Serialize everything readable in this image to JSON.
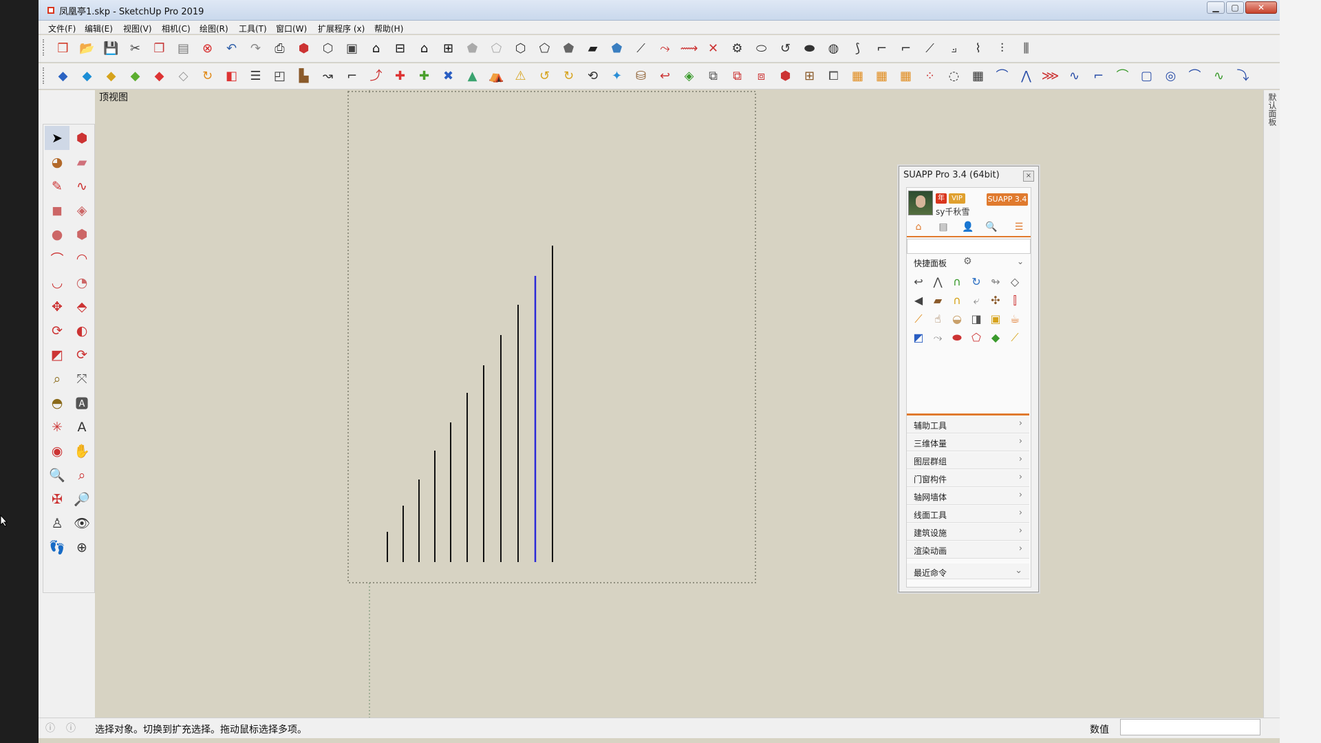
{
  "window": {
    "title": "凤凰亭1.skp - SketchUp Pro 2019",
    "buttons": {
      "minimize": "▁",
      "maximize": "▢",
      "close": "✕"
    }
  },
  "menubar": {
    "items": [
      "文件(F)",
      "编辑(E)",
      "视图(V)",
      "相机(C)",
      "绘图(R)",
      "工具(T)",
      "窗口(W)",
      "扩展程序 (x)",
      "帮助(H)"
    ]
  },
  "viewport": {
    "scene_label": "顶视图"
  },
  "status": {
    "text": "选择对象。切换到扩充选择。拖动鼠标选择多项。",
    "value_label": "数值",
    "value": ""
  },
  "right_strip": {
    "tab_label": "默认面板"
  },
  "suapp": {
    "title": "SUAPP Pro 3.4 (64bit)",
    "close": "×",
    "user_name": "sy千秋雪",
    "badges": [
      "年",
      "VIP",
      "SUAPP 3.4"
    ],
    "quick_panel_label": "快捷面板",
    "categories": [
      "辅助工具",
      "三维体量",
      "图层群组",
      "门窗构件",
      "轴网墙体",
      "线面工具",
      "建筑设施",
      "渲染动画"
    ],
    "recent_label": "最近命令"
  },
  "icons": {
    "toolbar1": [
      "new-icon",
      "open-icon",
      "save-icon",
      "cut-icon",
      "copy-icon",
      "paste-icon",
      "erase-icon",
      "undo-icon",
      "redo-icon",
      "print-icon",
      "model-info-icon",
      "iso-view-icon",
      "top-view-icon",
      "front-view-icon",
      "right-view-icon",
      "back-view-icon",
      "left-view-icon",
      "xray-icon",
      "back-edges-icon",
      "wireframe-icon",
      "hidden-line-icon",
      "shaded-icon",
      "textured-icon",
      "monochrome-icon"
    ],
    "toolbar2": [
      "make-face-icon",
      "extrude-icon",
      "offset-icon",
      "fillet-icon",
      "chamfer-icon",
      "arc-icon",
      "curve-icon",
      "line-icon",
      "weld-icon",
      "spline-icon",
      "sweep-icon",
      "loft-icon",
      "grid-icon",
      "stairs-icon",
      "array-icon",
      "mirror-icon",
      "rotate-icon",
      "scale-icon",
      "move-icon",
      "align-icon"
    ],
    "palette": [
      "select-icon",
      "component-icon",
      "paint-icon",
      "eraser-icon",
      "pencil-icon",
      "freehand-icon",
      "rectangle-icon",
      "rotated-rect-icon",
      "circle-icon",
      "polygon-icon",
      "arc-icon",
      "two-point-arc-icon",
      "three-point-arc-icon",
      "pie-icon",
      "move-icon",
      "push-pull-icon",
      "rotate-icon",
      "follow-me-icon",
      "scale-icon",
      "offset-icon",
      "tape-icon",
      "dimension-icon",
      "protractor-icon",
      "text-icon",
      "axes-icon",
      "3d-text-icon",
      "orbit-icon",
      "pan-icon",
      "zoom-icon",
      "zoom-window-icon",
      "zoom-extents-icon",
      "previous-view-icon",
      "position-camera-icon",
      "look-around-icon",
      "walk-icon",
      "section-plane-icon"
    ]
  },
  "colors": {
    "viewport_bg": "#d7d3c3",
    "highlight_line": "#2a2ad8",
    "accent_orange": "#e07a2e"
  }
}
